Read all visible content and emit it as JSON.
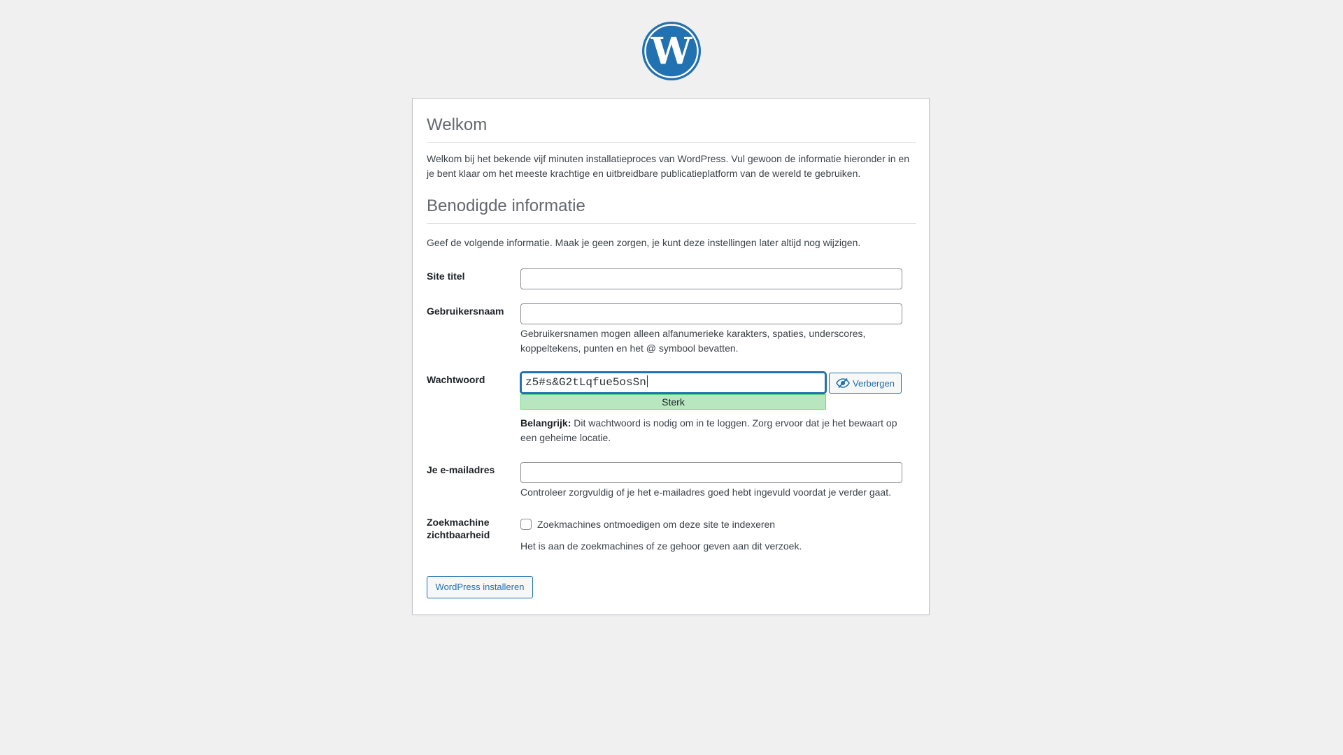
{
  "welcome": {
    "title": "Welkom",
    "intro": "Welkom bij het bekende vijf minuten installatieproces van WordPress. Vul gewoon de informatie hieronder in en je bent klaar om het meeste krachtige en uitbreidbare publicatieplatform van de wereld te gebruiken."
  },
  "required": {
    "title": "Benodigde informatie",
    "intro": "Geef de volgende informatie. Maak je geen zorgen, je kunt deze instellingen later altijd nog wijzigen."
  },
  "fields": {
    "site_title": {
      "label": "Site titel",
      "value": ""
    },
    "username": {
      "label": "Gebruikersnaam",
      "value": "",
      "description": "Gebruikersnamen mogen alleen alfanumerieke karakters, spaties, underscores, koppeltekens, punten en het @ symbool bevatten."
    },
    "password": {
      "label": "Wachtwoord",
      "value": "z5#s&G2tLqfue5osSn",
      "strength": "Sterk",
      "hide_label": "Verbergen",
      "important_prefix": "Belangrijk:",
      "important_text": "Dit wachtwoord is nodig om in te loggen. Zorg ervoor dat je het bewaart op een geheime locatie."
    },
    "email": {
      "label": "Je e-mailadres",
      "value": "",
      "description": "Controleer zorgvuldig of je het e-mailadres goed hebt ingevuld voordat je verder gaat."
    },
    "search_visibility": {
      "label_line1": "Zoekmachine",
      "label_line2": "zichtbaarheid",
      "checkbox_label": "Zoekmachines ontmoedigen om deze site te indexeren",
      "checked": false,
      "description": "Het is aan de zoekmachines of ze gehoor geven aan dit verzoek."
    }
  },
  "submit": {
    "label": "WordPress installeren"
  },
  "icons": {
    "logo": "wordpress-logo",
    "hide": "eye-slash-icon"
  },
  "colors": {
    "accent": "#2271b1",
    "strength_bg": "#b8e6bf",
    "strength_border": "#68de7c",
    "logo_blue": "#2271b1",
    "page_bg": "#f0f0f1"
  }
}
